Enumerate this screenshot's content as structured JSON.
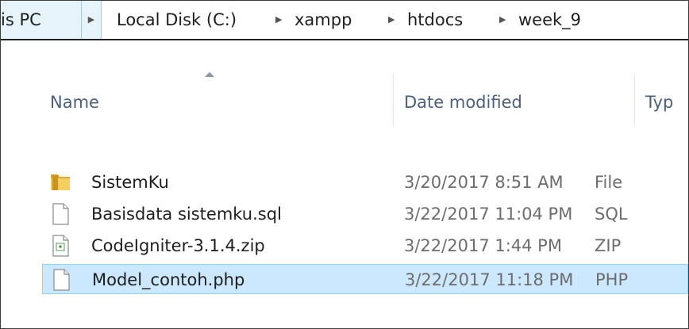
{
  "breadcrumb": {
    "items": [
      "is PC",
      "Local Disk (C:)",
      "xampp",
      "htdocs",
      "week_9"
    ]
  },
  "columns": {
    "name": "Name",
    "date": "Date modified",
    "type": "Typ"
  },
  "files": [
    {
      "name": "SistemKu",
      "date": "3/20/2017 8:51 AM",
      "type": "File",
      "icon": "folder-icon"
    },
    {
      "name": "Basisdata sistemku.sql",
      "date": "3/22/2017 11:04 PM",
      "type": "SQL",
      "icon": "document-icon"
    },
    {
      "name": "CodeIgniter-3.1.4.zip",
      "date": "3/22/2017 1:44 PM",
      "type": "ZIP",
      "icon": "zip-file-icon"
    },
    {
      "name": "Model_contoh.php",
      "date": "3/22/2017 11:18 PM",
      "type": "PHP",
      "icon": "document-icon",
      "selected": true
    }
  ],
  "colors": {
    "selection_bg": "#cce8ff",
    "selection_border": "#99d1ff",
    "header_text": "#4c607a",
    "folder": "#e8b840"
  }
}
